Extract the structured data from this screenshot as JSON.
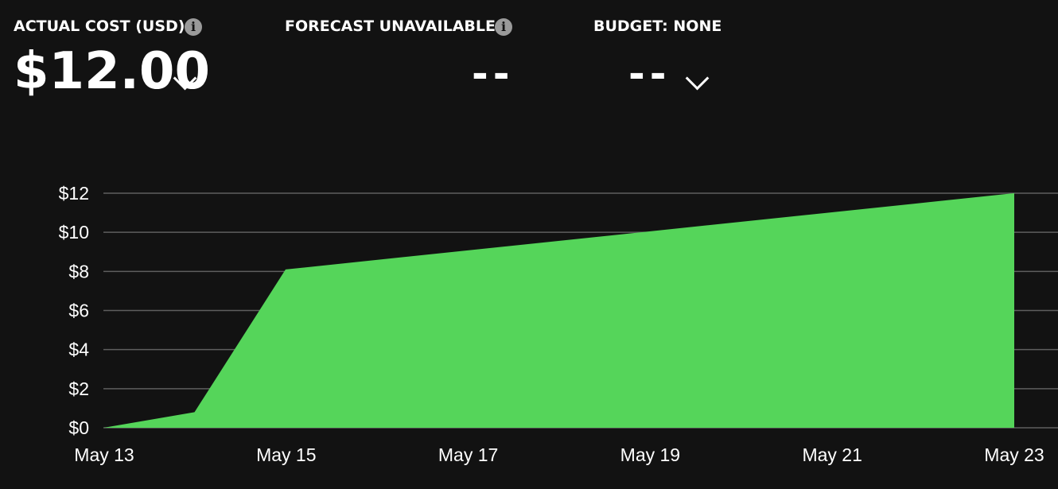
{
  "summary": {
    "actual": {
      "label": "ACTUAL COST (USD)",
      "value": "$12.00"
    },
    "forecast": {
      "label": "FORECAST UNAVAILABLE",
      "value": "--"
    },
    "budget": {
      "label": "BUDGET: NONE",
      "value": "--"
    }
  },
  "colors": {
    "background": "#121212",
    "area": "#55d55a",
    "grid": "#5e5e5e",
    "info_icon": "#9a9a9a"
  },
  "chart_data": {
    "type": "area",
    "title": "",
    "xlabel": "",
    "ylabel": "",
    "grid": true,
    "x_ticks": [
      "May 13",
      "May 15",
      "May 17",
      "May 19",
      "May 21",
      "May 23"
    ],
    "y_ticks": [
      "$0",
      "$2",
      "$4",
      "$6",
      "$8",
      "$10",
      "$12"
    ],
    "ylim": [
      0,
      12
    ],
    "xlim": [
      "2023-05-13",
      "2023-05-23"
    ],
    "series": [
      {
        "x": [
          "2023-05-13",
          "2023-05-14",
          "2023-05-15",
          "2023-05-23"
        ],
        "values": [
          0,
          0.8,
          8.1,
          12.0
        ]
      }
    ]
  }
}
